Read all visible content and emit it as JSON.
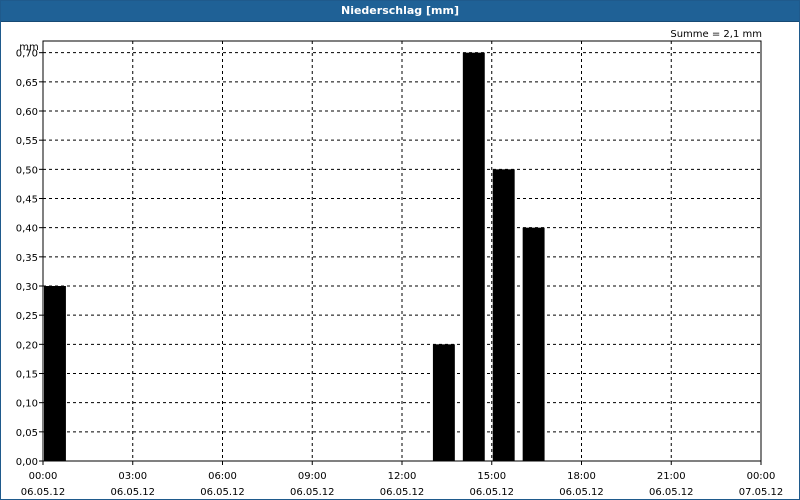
{
  "window": {
    "title": "Niederschlag [mm]"
  },
  "chart_data": {
    "type": "bar",
    "title": "Niederschlag [mm]",
    "ylabel": "mm",
    "annotation": "Summe = 2,1 mm",
    "ylim": [
      0,
      0.72
    ],
    "y_ticks": [
      "0,00",
      "0,05",
      "0,10",
      "0,15",
      "0,20",
      "0,25",
      "0,30",
      "0,35",
      "0,40",
      "0,45",
      "0,50",
      "0,55",
      "0,60",
      "0,65",
      "0,70"
    ],
    "x_ticks": [
      {
        "time": "00:00",
        "date": "06.05.12"
      },
      {
        "time": "03:00",
        "date": "06.05.12"
      },
      {
        "time": "06:00",
        "date": "06.05.12"
      },
      {
        "time": "09:00",
        "date": "06.05.12"
      },
      {
        "time": "12:00",
        "date": "06.05.12"
      },
      {
        "time": "15:00",
        "date": "06.05.12"
      },
      {
        "time": "18:00",
        "date": "06.05.12"
      },
      {
        "time": "21:00",
        "date": "06.05.12"
      },
      {
        "time": "00:00",
        "date": "07.05.12"
      }
    ],
    "bars": [
      {
        "time": "06.05.12 00:00",
        "value": 0.3
      },
      {
        "time": "06.05.12 13:00",
        "value": 0.2
      },
      {
        "time": "06.05.12 14:00",
        "value": 0.7
      },
      {
        "time": "06.05.12 15:00",
        "value": 0.5
      },
      {
        "time": "06.05.12 16:00",
        "value": 0.4
      }
    ],
    "grid": true,
    "bar_color": "#000000"
  }
}
